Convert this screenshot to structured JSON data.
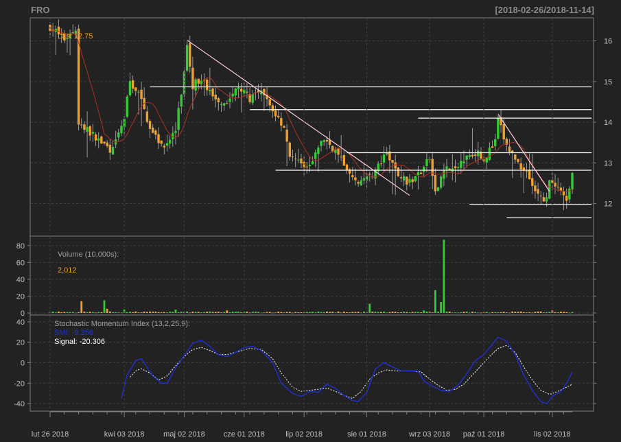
{
  "header": {
    "symbol": "FRO",
    "range": "[2018-02-26/2018-11-14]"
  },
  "colors": {
    "background": "#222222",
    "frame": "#7f7f7f",
    "grid": "#404040",
    "text": "#c0c0c0",
    "up": "#33cc33",
    "down": "#f0a030",
    "ma": "#b03020",
    "smi": "#2030e0",
    "signal": "#ffffff",
    "trendline": "#ffffff",
    "last_label": "#f0a030"
  },
  "chart_data": [
    {
      "type": "candlestick",
      "panel": "price",
      "last_label": "Last 12.75",
      "y_ticks": [
        "12",
        "13",
        "14",
        "15",
        "16"
      ],
      "ylim": [
        11.3,
        16.5
      ],
      "date_range": [
        "2018-02-26",
        "2018-11-14"
      ],
      "bars_per_week": 5,
      "x_ticks": [
        {
          "label": "lut 26 2018",
          "bar": 0
        },
        {
          "label": "kwi 03 2018",
          "bar": 26
        },
        {
          "label": "maj 02 2018",
          "bar": 47
        },
        {
          "label": "cze 01 2018",
          "bar": 68
        },
        {
          "label": "lip 02 2018",
          "bar": 89
        },
        {
          "label": "sie 01 2018",
          "bar": 111
        },
        {
          "label": "wrz 03 2018",
          "bar": 133
        },
        {
          "label": "paź 01 2018",
          "bar": 152
        },
        {
          "label": "lis 02 2018",
          "bar": 176
        }
      ],
      "price_anchors": [
        [
          0,
          16.35
        ],
        [
          5,
          16.05
        ],
        [
          9,
          16.3
        ],
        [
          10,
          14.0
        ],
        [
          16,
          13.6
        ],
        [
          22,
          13.3
        ],
        [
          26,
          14.1
        ],
        [
          28,
          15.0
        ],
        [
          31,
          14.7
        ],
        [
          36,
          13.7
        ],
        [
          40,
          13.4
        ],
        [
          44,
          13.8
        ],
        [
          47,
          15.2
        ],
        [
          48,
          15.95
        ],
        [
          50,
          14.9
        ],
        [
          53,
          15.1
        ],
        [
          57,
          14.6
        ],
        [
          62,
          14.5
        ],
        [
          66,
          14.85
        ],
        [
          70,
          14.6
        ],
        [
          74,
          14.7
        ],
        [
          78,
          14.3
        ],
        [
          82,
          13.9
        ],
        [
          84,
          13.2
        ],
        [
          88,
          12.9
        ],
        [
          92,
          13.1
        ],
        [
          96,
          13.6
        ],
        [
          100,
          13.3
        ],
        [
          104,
          12.8
        ],
        [
          106,
          12.6
        ],
        [
          110,
          12.55
        ],
        [
          114,
          12.8
        ],
        [
          118,
          13.2
        ],
        [
          122,
          12.7
        ],
        [
          126,
          12.5
        ],
        [
          130,
          12.8
        ],
        [
          133,
          13.1
        ],
        [
          135,
          12.2
        ],
        [
          138,
          12.9
        ],
        [
          142,
          12.8
        ],
        [
          146,
          13.2
        ],
        [
          150,
          13.3
        ],
        [
          152,
          13.1
        ],
        [
          156,
          13.5
        ],
        [
          157,
          14.05
        ],
        [
          160,
          13.4
        ],
        [
          164,
          13.0
        ],
        [
          167,
          12.8
        ],
        [
          170,
          12.3
        ],
        [
          173,
          12.0
        ],
        [
          175,
          12.5
        ],
        [
          178,
          12.3
        ],
        [
          181,
          12.1
        ],
        [
          183,
          12.75
        ]
      ],
      "horizontal_levels": [
        {
          "y": 14.87,
          "from_bar": 35,
          "to_bar": 184
        },
        {
          "y": 14.31,
          "from_bar": 70,
          "to_bar": 184
        },
        {
          "y": 14.1,
          "from_bar": 129,
          "to_bar": 184
        },
        {
          "y": 13.25,
          "from_bar": 104,
          "to_bar": 184
        },
        {
          "y": 12.82,
          "from_bar": 79,
          "to_bar": 184
        },
        {
          "y": 11.98,
          "from_bar": 147,
          "to_bar": 184
        },
        {
          "y": 11.65,
          "from_bar": 160,
          "to_bar": 184
        }
      ],
      "trendlines": [
        {
          "from": [
            48,
            16.02
          ],
          "to": [
            126,
            12.2
          ]
        },
        {
          "from": [
            157,
            14.2
          ],
          "to": [
            175,
            12.3
          ]
        }
      ]
    },
    {
      "type": "bar",
      "panel": "volume",
      "title": "Volume (10,000s):",
      "last_value": "2,012",
      "y_ticks": [
        "0",
        "20",
        "40",
        "60",
        "80"
      ],
      "ylim": [
        0,
        88
      ],
      "baseline": 1.0,
      "spikes": [
        [
          11,
          14
        ],
        [
          19,
          15
        ],
        [
          20,
          5
        ],
        [
          26,
          4
        ],
        [
          44,
          4
        ],
        [
          62,
          3
        ],
        [
          112,
          11
        ],
        [
          131,
          3
        ],
        [
          135,
          27
        ],
        [
          137,
          13
        ],
        [
          138,
          87
        ],
        [
          176,
          3
        ]
      ]
    },
    {
      "type": "line",
      "panel": "smi",
      "title": "Stochastic Momentum Index (13,2,25,9):",
      "smi_label": "SMI: -9.256",
      "signal_label": "Signal: -20.306",
      "y_ticks": [
        "-40",
        "-20",
        "0",
        "20",
        "40"
      ],
      "ylim": [
        -46,
        44
      ],
      "series": [
        {
          "key": "smi",
          "anchors": [
            [
              25,
              -35
            ],
            [
              27,
              -12
            ],
            [
              30,
              2
            ],
            [
              32,
              4
            ],
            [
              36,
              -13
            ],
            [
              39,
              -20
            ],
            [
              41,
              -20
            ],
            [
              44,
              -5
            ],
            [
              47,
              7
            ],
            [
              50,
              19
            ],
            [
              53,
              22
            ],
            [
              56,
              16
            ],
            [
              59,
              8
            ],
            [
              62,
              6
            ],
            [
              65,
              10
            ],
            [
              68,
              15
            ],
            [
              71,
              16
            ],
            [
              74,
              12
            ],
            [
              78,
              0
            ],
            [
              81,
              -20
            ],
            [
              85,
              -30
            ],
            [
              88,
              -33
            ],
            [
              91,
              -28
            ],
            [
              94,
              -29
            ],
            [
              97,
              -21
            ],
            [
              100,
              -25
            ],
            [
              103,
              -32
            ],
            [
              106,
              -37
            ],
            [
              108,
              -38
            ],
            [
              111,
              -29
            ],
            [
              114,
              -6
            ],
            [
              117,
              0
            ],
            [
              120,
              -4
            ],
            [
              123,
              -8
            ],
            [
              126,
              -8
            ],
            [
              129,
              -8
            ],
            [
              131,
              -18
            ],
            [
              134,
              -23
            ],
            [
              137,
              -27
            ],
            [
              140,
              -28
            ],
            [
              143,
              -22
            ],
            [
              146,
              -11
            ],
            [
              149,
              2
            ],
            [
              152,
              8
            ],
            [
              155,
              18
            ],
            [
              157,
              25
            ],
            [
              160,
              21
            ],
            [
              163,
              8
            ],
            [
              166,
              -12
            ],
            [
              169,
              -27
            ],
            [
              172,
              -38
            ],
            [
              174,
              -40
            ],
            [
              176,
              -33
            ],
            [
              179,
              -28
            ],
            [
              181,
              -20
            ],
            [
              183,
              -9
            ]
          ]
        },
        {
          "key": "signal",
          "anchors": [
            [
              28,
              -14
            ],
            [
              30,
              -8
            ],
            [
              32,
              -6
            ],
            [
              35,
              -10
            ],
            [
              38,
              -17
            ],
            [
              41,
              -13
            ],
            [
              44,
              -3
            ],
            [
              47,
              6
            ],
            [
              50,
              13
            ],
            [
              53,
              15
            ],
            [
              56,
              12
            ],
            [
              59,
              8
            ],
            [
              62,
              8
            ],
            [
              66,
              11
            ],
            [
              70,
              14
            ],
            [
              74,
              13
            ],
            [
              78,
              4
            ],
            [
              81,
              -10
            ],
            [
              85,
              -24
            ],
            [
              88,
              -28
            ],
            [
              91,
              -27
            ],
            [
              94,
              -26
            ],
            [
              97,
              -25
            ],
            [
              100,
              -28
            ],
            [
              103,
              -32
            ],
            [
              106,
              -35
            ],
            [
              109,
              -28
            ],
            [
              112,
              -16
            ],
            [
              115,
              -10
            ],
            [
              118,
              -7
            ],
            [
              121,
              -8
            ],
            [
              124,
              -8
            ],
            [
              127,
              -8
            ],
            [
              130,
              -9
            ],
            [
              133,
              -16
            ],
            [
              136,
              -22
            ],
            [
              139,
              -27
            ],
            [
              142,
              -26
            ],
            [
              145,
              -21
            ],
            [
              148,
              -12
            ],
            [
              151,
              -3
            ],
            [
              154,
              6
            ],
            [
              157,
              14
            ],
            [
              160,
              17
            ],
            [
              163,
              10
            ],
            [
              166,
              -4
            ],
            [
              169,
              -17
            ],
            [
              172,
              -27
            ],
            [
              175,
              -31
            ],
            [
              178,
              -28
            ],
            [
              181,
              -24
            ],
            [
              183,
              -21
            ]
          ]
        }
      ]
    }
  ]
}
